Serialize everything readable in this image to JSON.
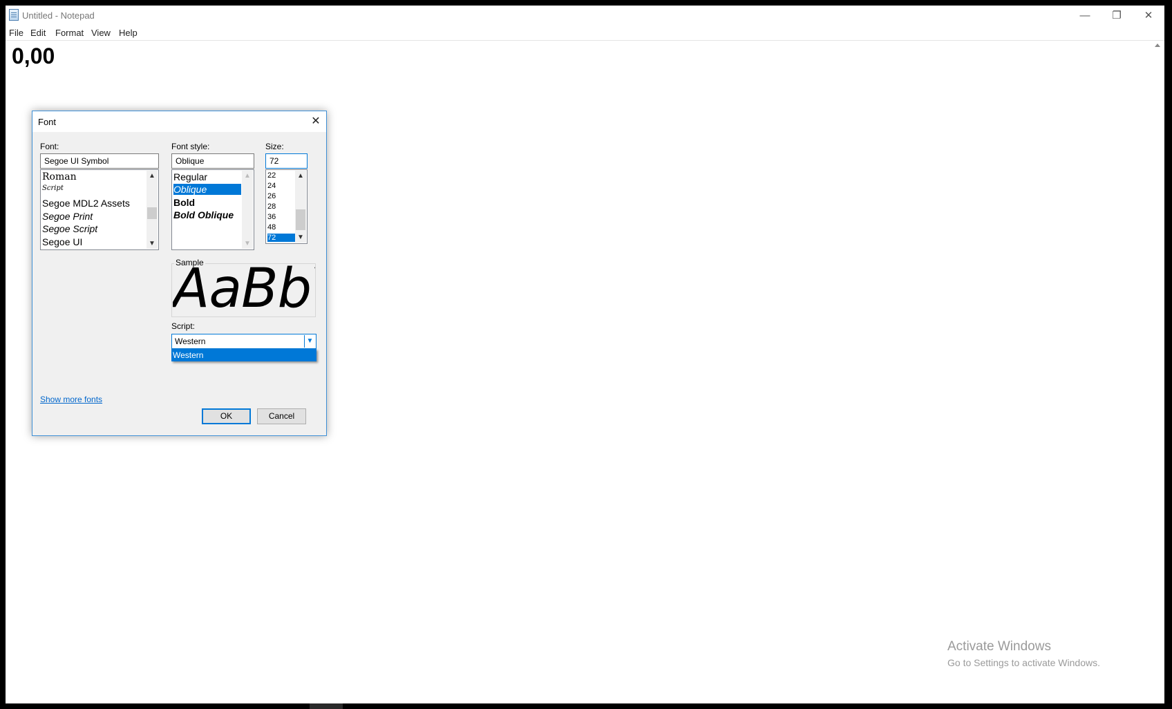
{
  "window": {
    "title": "Untitled - Notepad",
    "controls": {
      "minimize": "—",
      "maximize": "❐",
      "close": "✕"
    }
  },
  "menu": [
    "File",
    "Edit",
    "Format",
    "View",
    "Help"
  ],
  "editor": {
    "content": "0,00"
  },
  "font_dialog": {
    "title": "Font",
    "font_label": "Font:",
    "font_value": "Segoe UI Symbol",
    "font_list": [
      "Roman",
      "Script",
      "Segoe MDL2 Assets",
      "Segoe Print",
      "Segoe Script",
      "Segoe UI"
    ],
    "style_label": "Font style:",
    "style_value": "Oblique",
    "style_list": [
      "Regular",
      "Oblique",
      "Bold",
      "Bold Oblique"
    ],
    "style_selected": "Oblique",
    "size_label": "Size:",
    "size_value": "72",
    "size_list": [
      "22",
      "24",
      "26",
      "28",
      "36",
      "48",
      "72"
    ],
    "size_selected": "72",
    "sample_label": "Sample",
    "sample_text": "AaBbYyZz",
    "script_label": "Script:",
    "script_value": "Western",
    "script_options": [
      "Western"
    ],
    "show_more_fonts": "Show more fonts",
    "ok_label": "OK",
    "cancel_label": "Cancel"
  },
  "watermark": {
    "title": "Activate Windows",
    "subtitle": "Go to Settings to activate Windows."
  },
  "colors": {
    "accent": "#0078d7",
    "dialog_bg": "#f0f0f0"
  }
}
